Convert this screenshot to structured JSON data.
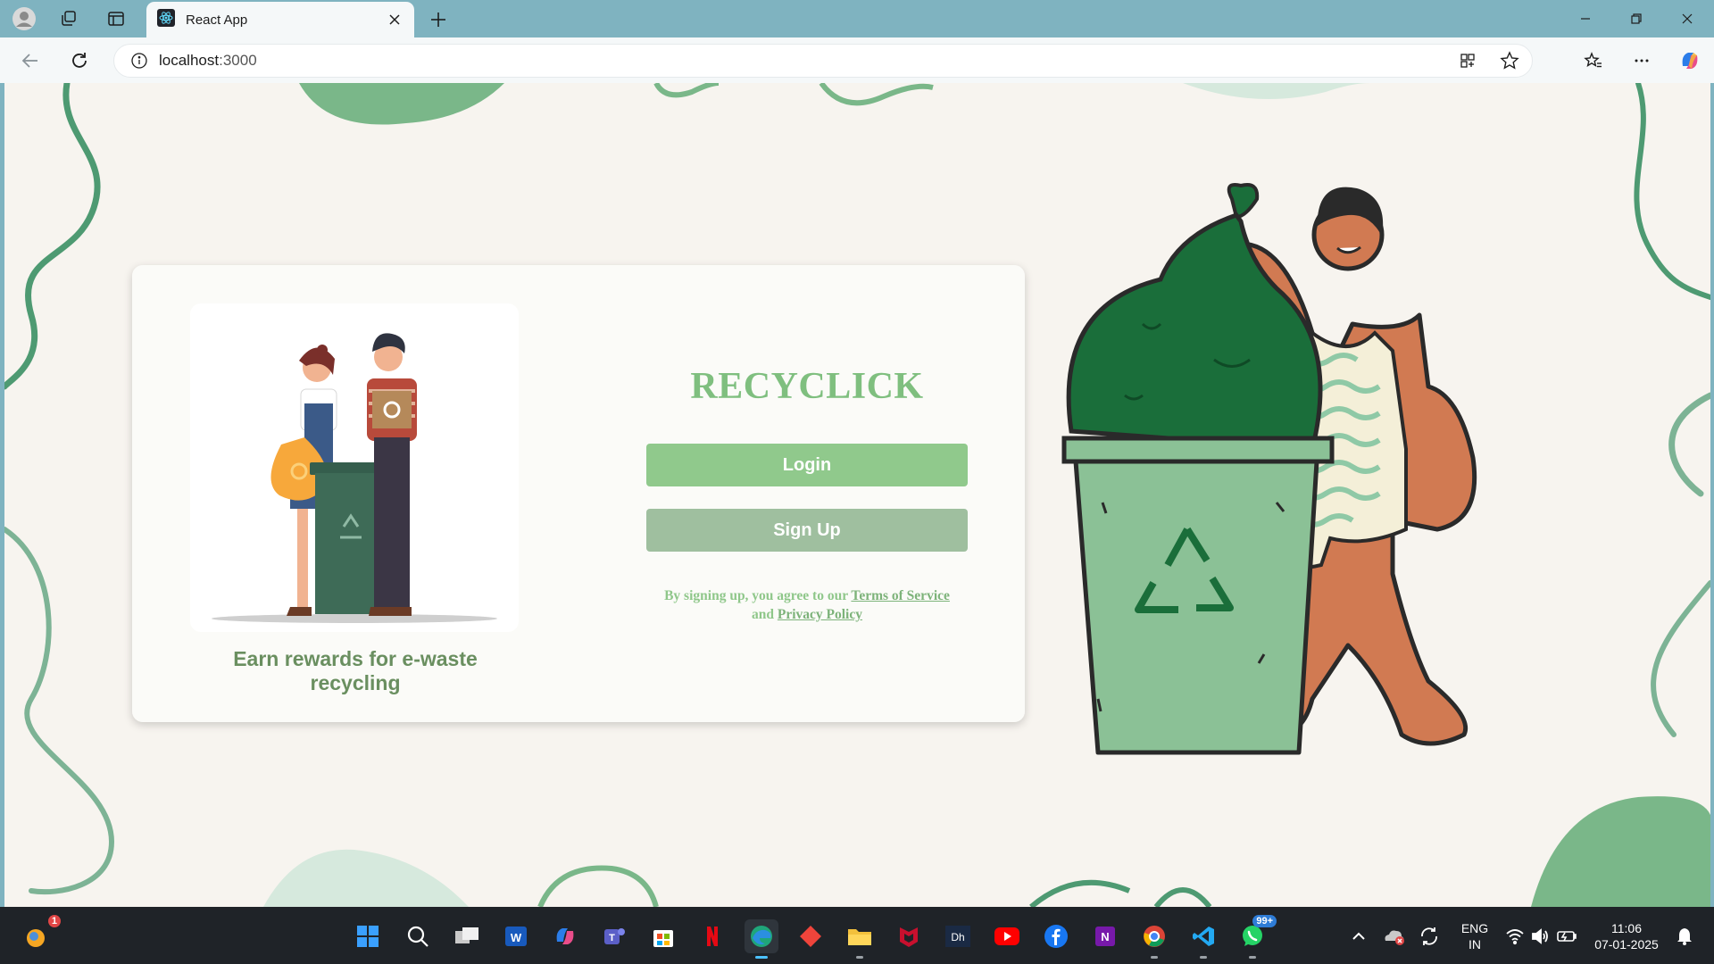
{
  "browser": {
    "tab_title": "React App",
    "url_host": "localhost",
    "url_port": ":3000"
  },
  "page": {
    "brand": "RECYCLICK",
    "tagline": "Earn rewards for e-waste recycling",
    "login_label": "Login",
    "signup_label": "Sign Up",
    "terms_prefix": "By signing up, you agree to our",
    "terms_link": "Terms of Service",
    "terms_and": "and",
    "privacy_link": "Privacy Policy",
    "colors": {
      "accent_green": "#90c98c",
      "secondary_green": "#9fbf9f",
      "brand_green": "#7fbf7f",
      "page_bg": "#f7f4ef"
    }
  },
  "taskbar": {
    "widgets_badge": "1",
    "whatsapp_badge": "99+",
    "lang_top": "ENG",
    "lang_bottom": "IN",
    "time": "11:06",
    "date": "07-01-2025"
  }
}
